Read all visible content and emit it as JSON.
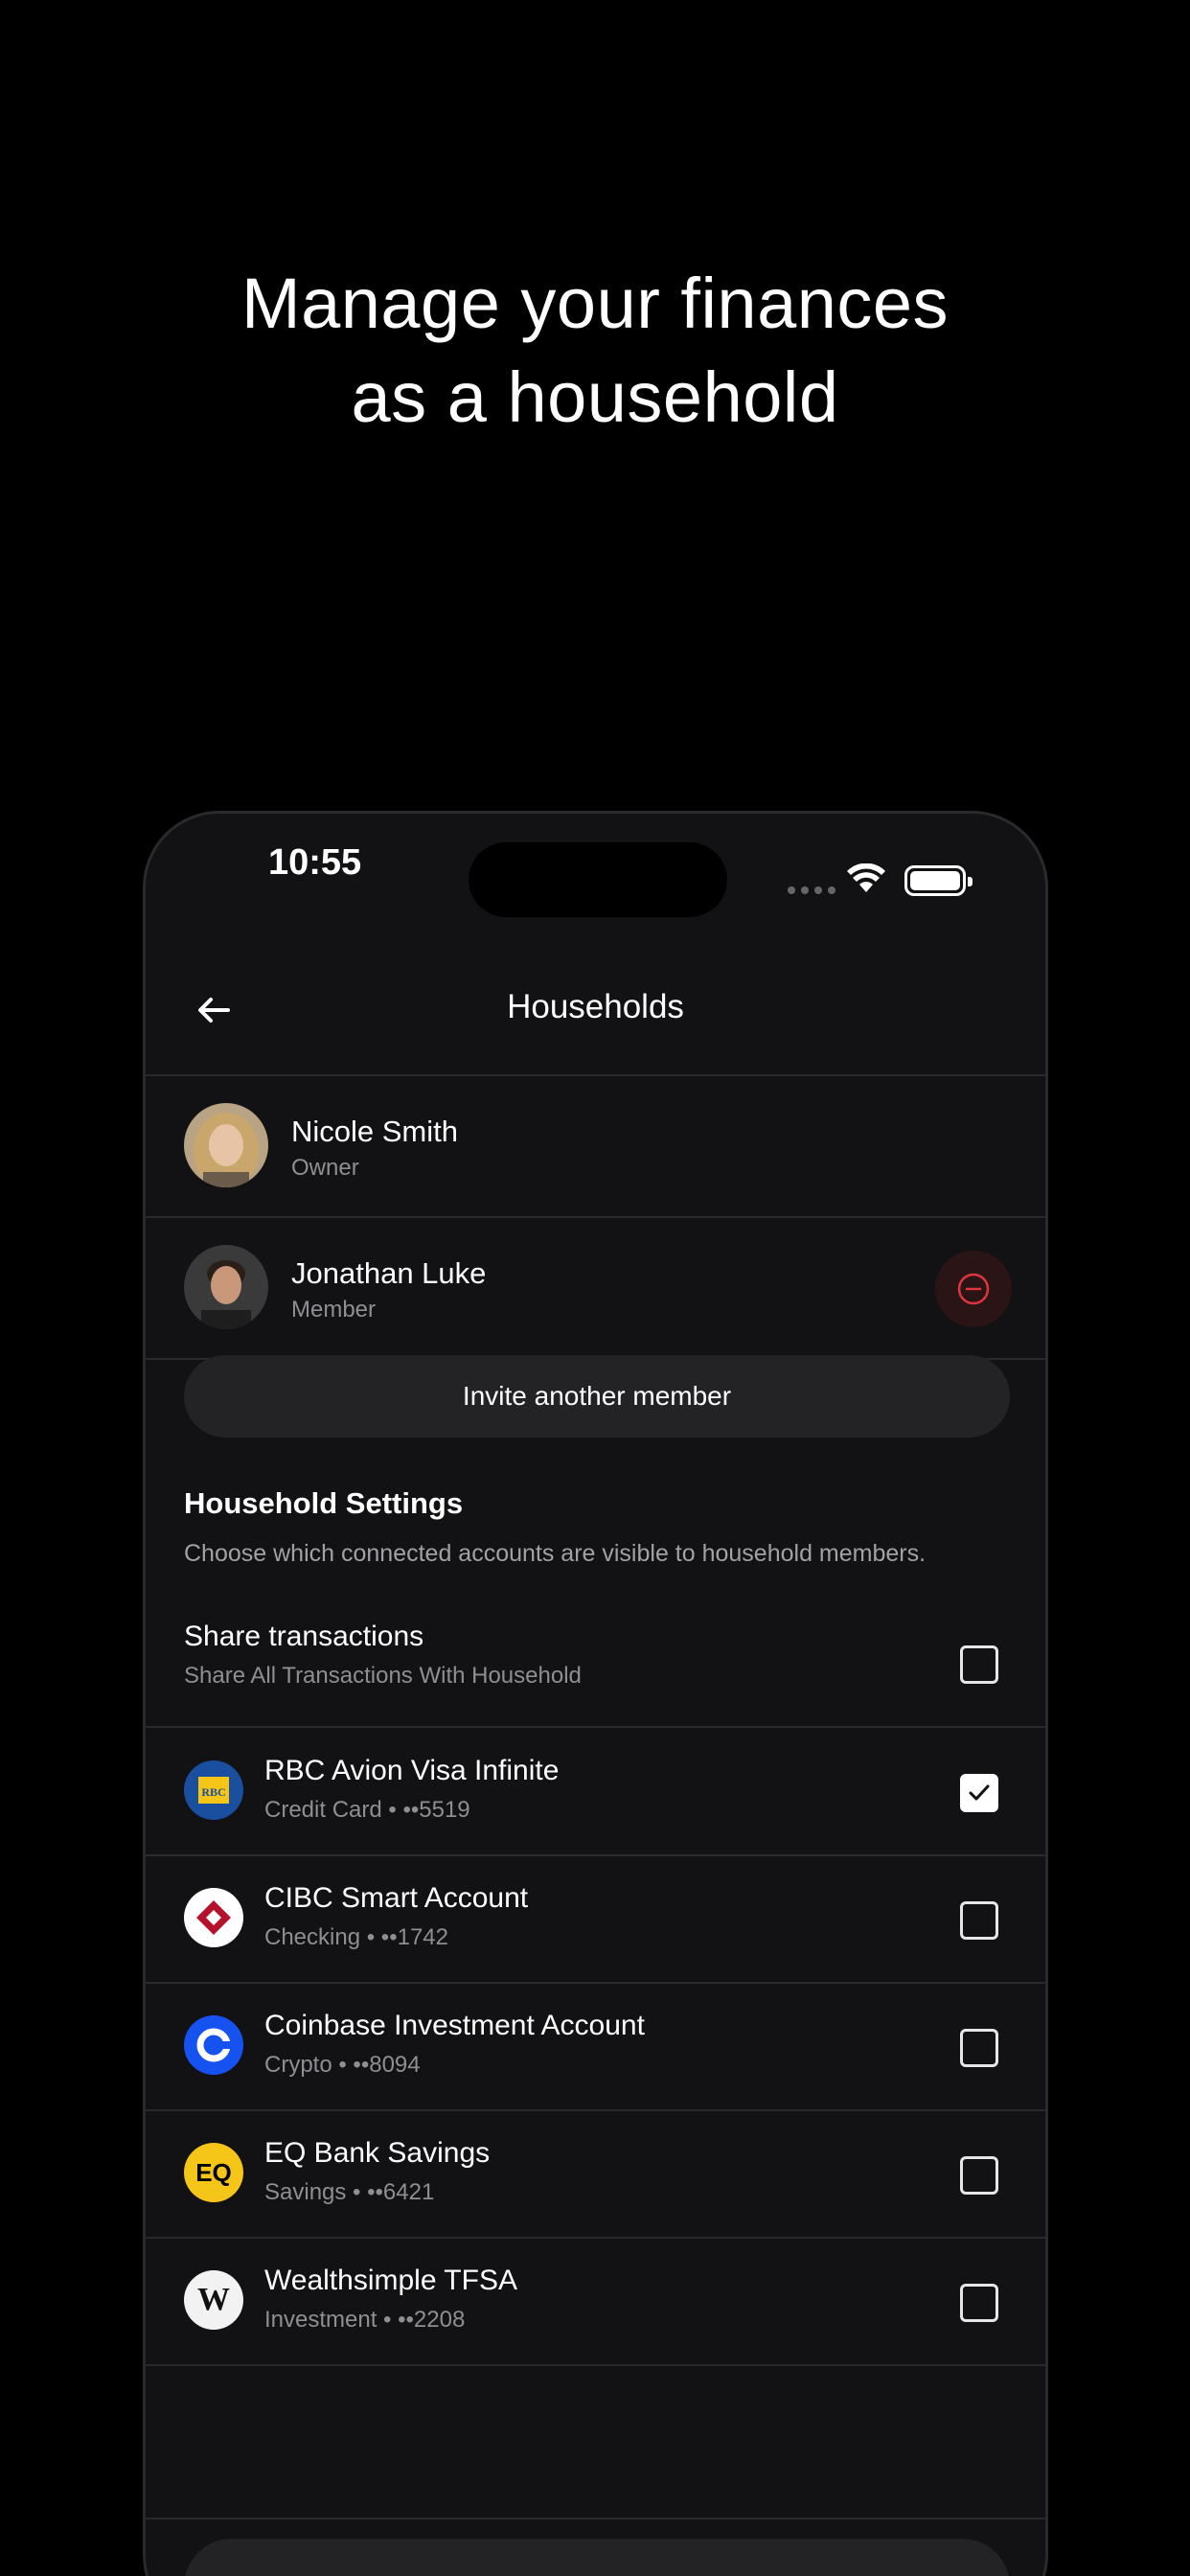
{
  "hero": {
    "line1": "Manage your finances",
    "line2": "as a household"
  },
  "status_bar": {
    "time": "10:55"
  },
  "nav": {
    "title": "Households",
    "back_icon": "arrow-left-icon"
  },
  "members": [
    {
      "name": "Nicole Smith",
      "role": "Owner"
    },
    {
      "name": "Jonathan Luke",
      "role": "Member",
      "remove_icon": "minus-circle-icon"
    }
  ],
  "invite_button": "Invite another member",
  "settings": {
    "title": "Household Settings",
    "description": "Choose which connected accounts are visible to household members.",
    "share": {
      "title": "Share transactions",
      "subtitle": "Share All Transactions With Household",
      "checked": false
    }
  },
  "accounts": [
    {
      "name": "RBC Avion Visa Infinite",
      "subtitle": "Credit Card • ••5519",
      "logo": "RBC",
      "checked": true
    },
    {
      "name": "CIBC Smart Account",
      "subtitle": "Checking • ••1742",
      "logo": "CIBC",
      "checked": false
    },
    {
      "name": "Coinbase Investment Account",
      "subtitle": "Crypto • ••8094",
      "logo": "Coinbase",
      "checked": false
    },
    {
      "name": "EQ Bank Savings",
      "subtitle": "Savings • ••6421",
      "logo": "EQ",
      "checked": false
    },
    {
      "name": "Wealthsimple TFSA",
      "subtitle": "Investment • ••2208",
      "logo": "W",
      "checked": false
    }
  ],
  "colors": {
    "background": "#000000",
    "panel": "#121214",
    "accent_red": "#e0353d",
    "muted": "#8e8e93"
  }
}
